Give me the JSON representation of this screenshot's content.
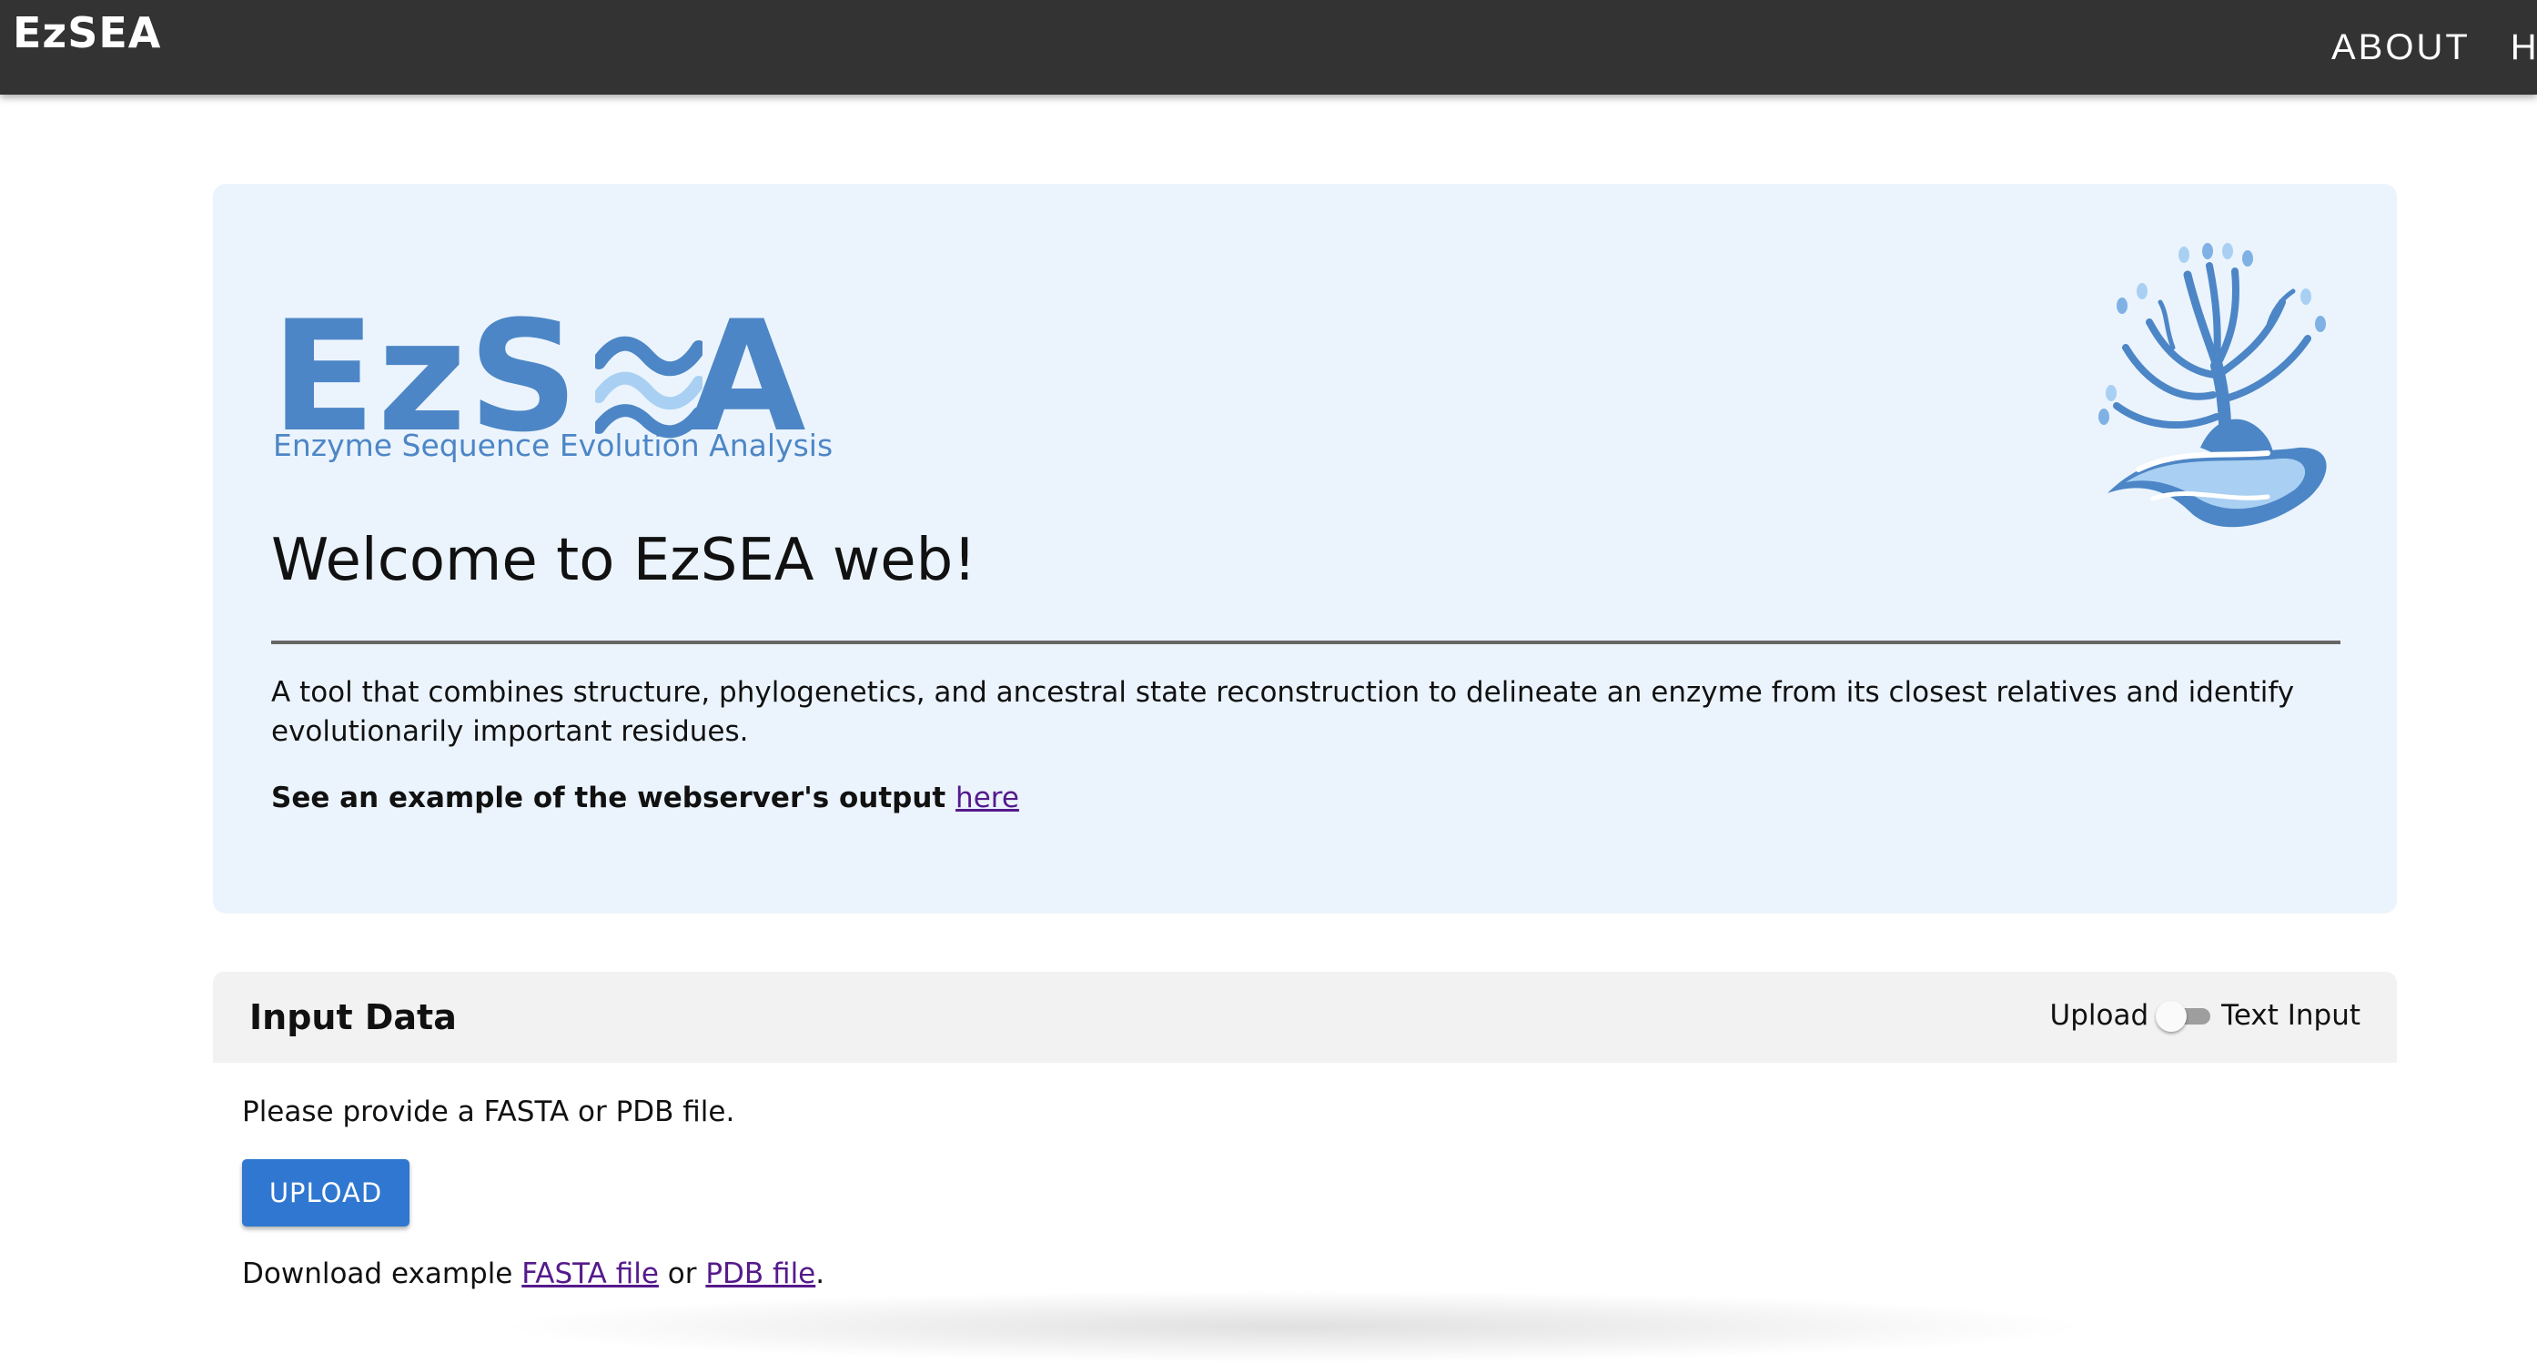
{
  "navbar": {
    "brand": "EzSEA",
    "links": [
      "ABOUT",
      "HE"
    ]
  },
  "hero": {
    "logo": {
      "wordmark_left": "EzS",
      "wordmark_right": "A",
      "tagline": "Enzyme Sequence Evolution Analysis"
    },
    "title": "Welcome to EzSEA web!",
    "description": "A tool that combines structure, phylogenetics, and ancestral state reconstruction to delineate an enzyme from its closest relatives and identify evolutionarily important residues.",
    "example_prefix": "See an example of the webserver's output",
    "example_link": "here"
  },
  "input_data": {
    "title": "Input Data",
    "toggle_left": "Upload",
    "toggle_right": "Text Input",
    "toggle_on": false,
    "prompt": "Please provide a FASTA or PDB file.",
    "upload_label": "UPLOAD",
    "download_prefix": "Download example",
    "fasta_link": "FASTA file",
    "or_text": "or",
    "pdb_link": "PDB file",
    "period": "."
  },
  "colors": {
    "navbar_bg": "#333333",
    "hero_bg": "#ebf4fd",
    "logo_blue": "#4d86c6",
    "logo_light_blue": "#a9d0f3",
    "button_blue": "#2f77d0",
    "link_purple": "#551a8b"
  },
  "icons": {
    "logo_wave": "wave-e-icon",
    "tree_logo": "tree-wave-logo-icon"
  }
}
